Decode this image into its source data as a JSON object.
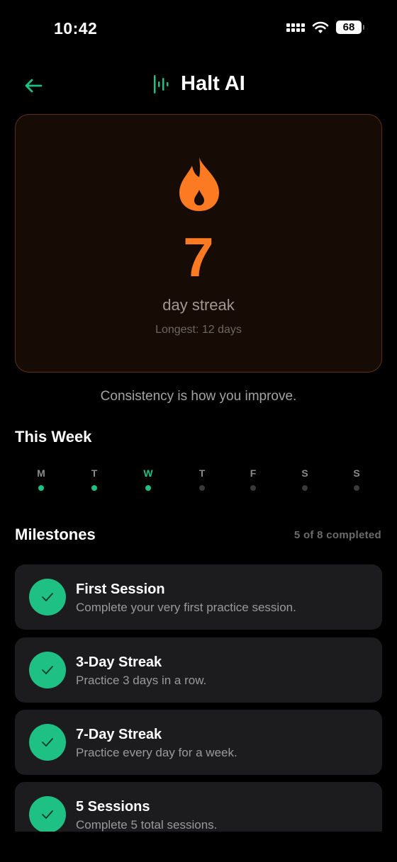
{
  "status_bar": {
    "time": "10:42",
    "battery": "68"
  },
  "header": {
    "title": "Halt AI"
  },
  "streak": {
    "count": "7",
    "label": "day streak",
    "longest": "Longest: 12 days"
  },
  "tagline": "Consistency is how you improve.",
  "week": {
    "title": "This Week",
    "days": [
      {
        "letter": "M",
        "done": true
      },
      {
        "letter": "T",
        "done": true
      },
      {
        "letter": "W",
        "done": true,
        "today": true
      },
      {
        "letter": "T",
        "done": false
      },
      {
        "letter": "F",
        "done": false
      },
      {
        "letter": "S",
        "done": false
      },
      {
        "letter": "S",
        "done": false
      }
    ]
  },
  "milestones": {
    "title": "Milestones",
    "count": "5 of 8 completed",
    "items": [
      {
        "title": "First Session",
        "desc": "Complete your very first practice session."
      },
      {
        "title": "3-Day Streak",
        "desc": "Practice 3 days in a row."
      },
      {
        "title": "7-Day Streak",
        "desc": "Practice every day for a week."
      },
      {
        "title": "5 Sessions",
        "desc": "Complete 5 total sessions."
      }
    ]
  },
  "colors": {
    "accent": "#1fc083",
    "streak": "#fb7a22",
    "card_bg": "#170c05",
    "card_border": "#5a3018"
  },
  "icons": {
    "back": "arrow-left-icon",
    "brand": "waveform-icon",
    "streak": "flame-icon",
    "milestone": "check-icon"
  }
}
